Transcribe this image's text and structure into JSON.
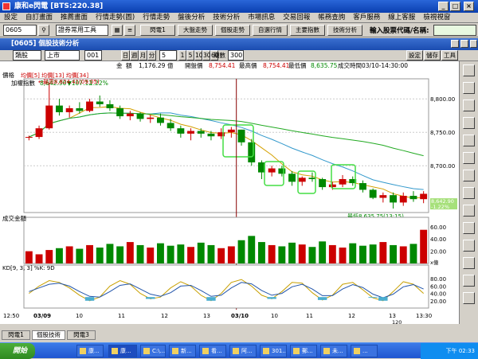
{
  "window": {
    "title": "康和e閃電 [BTS:220.38]"
  },
  "menu": [
    "設定",
    "自訂畫面",
    "推薦畫面",
    "行情走勢(圖)",
    "行情走勢",
    "盤後分析",
    "技術分析",
    "市場訊息",
    "交易回報",
    "帳務查詢",
    "客戶服務",
    "線上客服",
    "檢視視窗"
  ],
  "toolbar": {
    "code": "0605",
    "tool_select": "證券常用工具",
    "buttons": [
      "閃電1",
      "大盤走勢",
      "個股走勢",
      "自選行情",
      "主要指數",
      "技術分析"
    ],
    "search_label": "輸入股票代碼/名稱:"
  },
  "doc": {
    "title": "[0605] 個股技術分析"
  },
  "options": {
    "type": "類股",
    "market": "上市",
    "code": "001",
    "periods": [
      "日",
      "週",
      "月",
      "分"
    ],
    "minutes": "5",
    "steps": [
      "1",
      "5",
      "10",
      "30",
      "60"
    ],
    "period_label": "期數",
    "period_value": "300",
    "right_buttons": [
      "設定",
      "儲存",
      "工具"
    ]
  },
  "info": {
    "group_label": "金",
    "volume_label": "額",
    "volume": "1,176.29",
    "unit": "億",
    "price_label": "開盤價",
    "open": "8,754.41",
    "high_label": "最高價",
    "high": "8,754.41",
    "low_label": "最低價",
    "low": "8,635.75",
    "time_label": "成交時間",
    "time": "03/10-14:30:00"
  },
  "chart": {
    "price_panel": {
      "label": "價格",
      "ma_label": "均價[5] 均價[13] 均價[34]",
      "name": "加權指數",
      "last": "8,642.90",
      "change": "▼107.12",
      "change_pct": "1.22%",
      "high_note": "←最高8,824.41(09:05)",
      "low_note": "最低8,635.75(13:15)",
      "yticks": [
        "8,800.00",
        "8,750.00",
        "8,700.00"
      ],
      "last_tag": "8,642.90",
      "pct_tag": "-1.22%"
    },
    "volume_panel": {
      "label": "成交金額",
      "yticks": [
        "60.00",
        "40.00",
        "20.00"
      ],
      "unit": "x億"
    },
    "kd_panel": {
      "label": "KD[9, 3, 3] %K: 9D",
      "yticks": [
        "80.00",
        "60.00",
        "40.00",
        "20.00"
      ]
    },
    "xaxis": [
      "12:50",
      "03/09",
      "10",
      "11",
      "12",
      "13",
      "03/10",
      "10",
      "11",
      "12",
      "13",
      "13:30"
    ],
    "zoom": "120"
  },
  "chart_data": {
    "type": "line",
    "title": "加權指數",
    "ohlc": [
      [
        8742,
        8745,
        8738,
        8743
      ],
      [
        8743,
        8760,
        8740,
        8756
      ],
      [
        8756,
        8824,
        8754,
        8790
      ],
      [
        8790,
        8800,
        8775,
        8780
      ],
      [
        8780,
        8790,
        8772,
        8786
      ],
      [
        8786,
        8795,
        8778,
        8782
      ],
      [
        8782,
        8800,
        8780,
        8796
      ],
      [
        8796,
        8805,
        8788,
        8792
      ],
      [
        8792,
        8798,
        8782,
        8786
      ],
      [
        8786,
        8790,
        8770,
        8774
      ],
      [
        8774,
        8782,
        8768,
        8778
      ],
      [
        8778,
        8780,
        8766,
        8770
      ],
      [
        8770,
        8776,
        8764,
        8772
      ],
      [
        8772,
        8778,
        8760,
        8764
      ],
      [
        8764,
        8770,
        8752,
        8756
      ],
      [
        8756,
        8760,
        8742,
        8748
      ],
      [
        8748,
        8756,
        8738,
        8752
      ],
      [
        8752,
        8756,
        8742,
        8748
      ],
      [
        8748,
        8752,
        8738,
        8744
      ],
      [
        8744,
        8756,
        8740,
        8750
      ],
      [
        8750,
        8758,
        8742,
        8754
      ],
      [
        8754,
        8754,
        8730,
        8735
      ],
      [
        8735,
        8740,
        8700,
        8705
      ],
      [
        8705,
        8708,
        8680,
        8690
      ],
      [
        8690,
        8700,
        8684,
        8696
      ],
      [
        8696,
        8700,
        8684,
        8688
      ],
      [
        8688,
        8692,
        8670,
        8676
      ],
      [
        8676,
        8684,
        8670,
        8682
      ],
      [
        8682,
        8690,
        8676,
        8680
      ],
      [
        8680,
        8682,
        8664,
        8668
      ],
      [
        8668,
        8676,
        8664,
        8672
      ],
      [
        8672,
        8686,
        8668,
        8680
      ],
      [
        8680,
        8684,
        8670,
        8674
      ],
      [
        8674,
        8678,
        8660,
        8664
      ],
      [
        8664,
        8666,
        8650,
        8652
      ],
      [
        8652,
        8660,
        8645,
        8656
      ],
      [
        8656,
        8660,
        8636,
        8645
      ],
      [
        8645,
        8660,
        8640,
        8655
      ],
      [
        8655,
        8662,
        8646,
        8650
      ],
      [
        8650,
        8662,
        8644,
        8658
      ]
    ],
    "volume": [
      20,
      15,
      22,
      25,
      28,
      24,
      30,
      26,
      32,
      28,
      35,
      30,
      26,
      33,
      29,
      31,
      27,
      34,
      30,
      25,
      28,
      38,
      45,
      35,
      30,
      28,
      34,
      31,
      27,
      36,
      30,
      26,
      33,
      29,
      31,
      35,
      30,
      28,
      32,
      55
    ],
    "kd_k": [
      40,
      60,
      75,
      70,
      55,
      35,
      20,
      30,
      60,
      75,
      65,
      40,
      25,
      30,
      55,
      72,
      60,
      35,
      20,
      40,
      70,
      78,
      60,
      35,
      25,
      45,
      70,
      68,
      42,
      22,
      35,
      65,
      70,
      50,
      28,
      20,
      45,
      72,
      65,
      40
    ],
    "kd_d": [
      45,
      55,
      65,
      68,
      60,
      45,
      32,
      30,
      45,
      62,
      66,
      52,
      38,
      32,
      42,
      60,
      62,
      48,
      32,
      35,
      55,
      70,
      66,
      48,
      35,
      40,
      58,
      65,
      52,
      34,
      34,
      52,
      64,
      56,
      38,
      28,
      38,
      58,
      64,
      52
    ]
  }
}
